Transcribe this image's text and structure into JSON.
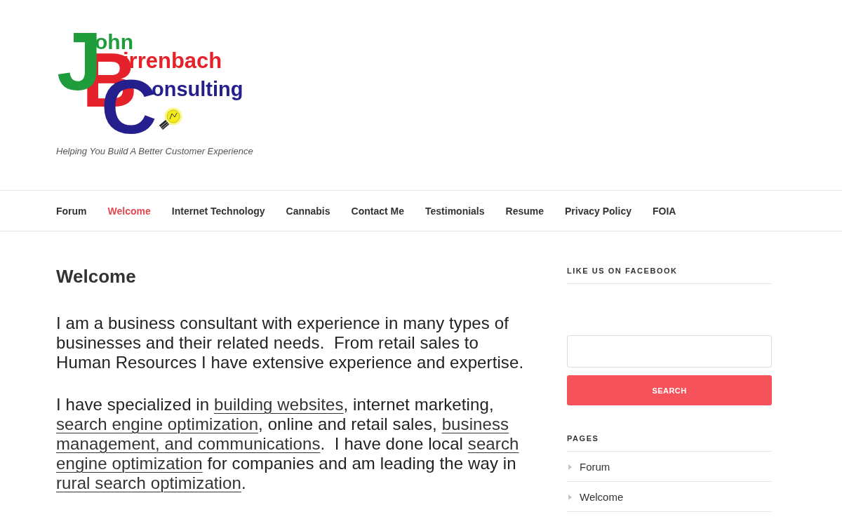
{
  "header": {
    "logo": {
      "words": [
        {
          "initial": "J",
          "rest": "ohn",
          "color": "#1f9c3c"
        },
        {
          "initial": "B",
          "rest": "irrenbach",
          "color": "#e5222b"
        },
        {
          "initial": "C",
          "rest": "onsulting",
          "color": "#241f8c"
        }
      ]
    },
    "tagline": "Helping You Build A Better Customer Experience"
  },
  "nav": {
    "items": [
      {
        "label": "Forum",
        "selected": false
      },
      {
        "label": "Welcome",
        "selected": true
      },
      {
        "label": "Internet Technology",
        "selected": false
      },
      {
        "label": "Cannabis",
        "selected": false
      },
      {
        "label": "Contact Me",
        "selected": false
      },
      {
        "label": "Testimonials",
        "selected": false
      },
      {
        "label": "Resume",
        "selected": false
      },
      {
        "label": "Privacy Policy",
        "selected": false
      },
      {
        "label": "FOIA",
        "selected": false
      }
    ]
  },
  "content": {
    "title": "Welcome",
    "paragraphs": [
      {
        "segments": [
          {
            "kind": "text",
            "text": "I am a business consultant with experience in many types of businesses and their related needs.  From retail sales to Human Resources I have extensive experience and expertise."
          }
        ]
      },
      {
        "segments": [
          {
            "kind": "text",
            "text": "I have specialized in "
          },
          {
            "kind": "link",
            "text": "building websites"
          },
          {
            "kind": "text",
            "text": ", internet marketing, "
          },
          {
            "kind": "link",
            "text": "search engine optimization"
          },
          {
            "kind": "text",
            "text": ", online and retail sales, "
          },
          {
            "kind": "link",
            "parts": [
              "business",
              "management, and communications"
            ]
          },
          {
            "kind": "text",
            "text": ".  I have done local "
          },
          {
            "kind": "link",
            "parts": [
              "search",
              "engine optimization"
            ]
          },
          {
            "kind": "text",
            "text": " for companies and am leading the way in "
          },
          {
            "kind": "link",
            "text": "rural search optimization"
          },
          {
            "kind": "text",
            "text": "."
          }
        ]
      }
    ]
  },
  "sidebar": {
    "widgets": [
      {
        "kind": "facebook",
        "title": "LIKE US ON FACEBOOK"
      },
      {
        "kind": "search",
        "button": "SEARCH"
      },
      {
        "kind": "pages",
        "title": "PAGES",
        "items": [
          "Forum",
          "Welcome"
        ]
      }
    ]
  }
}
